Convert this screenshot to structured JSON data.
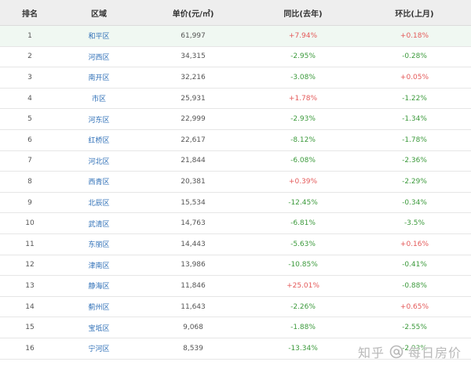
{
  "table": {
    "headers": {
      "rank": "排名",
      "area": "区域",
      "price": "单价(元/㎡)",
      "yoy": "同比(去年)",
      "mom": "环比(上月)"
    },
    "rows": [
      {
        "rank": "1",
        "area": "和平区",
        "price": "61,997",
        "yoy": "+7.94%",
        "mom": "+0.18%"
      },
      {
        "rank": "2",
        "area": "河西区",
        "price": "34,315",
        "yoy": "-2.95%",
        "mom": "-0.28%"
      },
      {
        "rank": "3",
        "area": "南开区",
        "price": "32,216",
        "yoy": "-3.08%",
        "mom": "+0.05%"
      },
      {
        "rank": "4",
        "area": "市区",
        "price": "25,931",
        "yoy": "+1.78%",
        "mom": "-1.22%"
      },
      {
        "rank": "5",
        "area": "河东区",
        "price": "22,999",
        "yoy": "-2.93%",
        "mom": "-1.34%"
      },
      {
        "rank": "6",
        "area": "红桥区",
        "price": "22,617",
        "yoy": "-8.12%",
        "mom": "-1.78%"
      },
      {
        "rank": "7",
        "area": "河北区",
        "price": "21,844",
        "yoy": "-6.08%",
        "mom": "-2.36%"
      },
      {
        "rank": "8",
        "area": "西青区",
        "price": "20,381",
        "yoy": "+0.39%",
        "mom": "-2.29%"
      },
      {
        "rank": "9",
        "area": "北辰区",
        "price": "15,534",
        "yoy": "-12.45%",
        "mom": "-0.34%"
      },
      {
        "rank": "10",
        "area": "武清区",
        "price": "14,763",
        "yoy": "-6.81%",
        "mom": "-3.5%"
      },
      {
        "rank": "11",
        "area": "东丽区",
        "price": "14,443",
        "yoy": "-5.63%",
        "mom": "+0.16%"
      },
      {
        "rank": "12",
        "area": "津南区",
        "price": "13,986",
        "yoy": "-10.85%",
        "mom": "-0.41%"
      },
      {
        "rank": "13",
        "area": "静海区",
        "price": "11,846",
        "yoy": "+25.01%",
        "mom": "-0.88%"
      },
      {
        "rank": "14",
        "area": "蓟州区",
        "price": "11,643",
        "yoy": "-2.26%",
        "mom": "+0.65%"
      },
      {
        "rank": "15",
        "area": "宝坻区",
        "price": "9,068",
        "yoy": "-1.88%",
        "mom": "-2.55%"
      },
      {
        "rank": "16",
        "area": "宁河区",
        "price": "8,539",
        "yoy": "-13.34%",
        "mom": "-2.93%"
      }
    ]
  },
  "watermark": {
    "site": "知乎",
    "author": "每日房价",
    "icon": "at-icon"
  },
  "colors": {
    "positive": "#e45a5a",
    "negative": "#3c9a3c",
    "area_link": "#2e6fb7",
    "header_bg": "#eeeeee",
    "highlight_row": "#f0f8f2"
  }
}
